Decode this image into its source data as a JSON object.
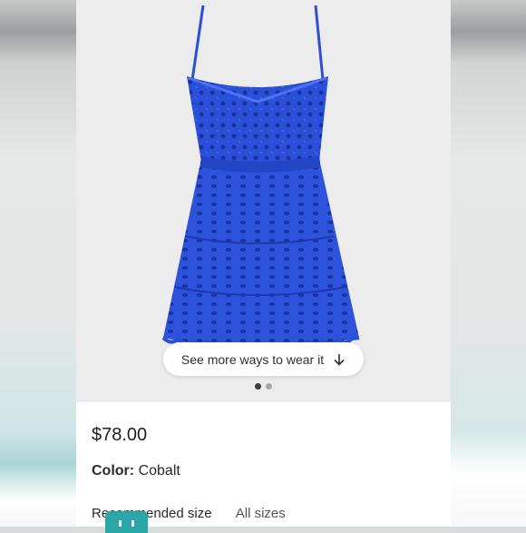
{
  "product": {
    "price": "$78.00",
    "color_label": "Color:",
    "color_value": "Cobalt",
    "dress_color": "#2a4fd8"
  },
  "gallery": {
    "wear_button_label": "See more ways to wear it",
    "wear_button_icon": "arrow-down-icon",
    "slide_count": 2,
    "active_slide": 1
  },
  "sizes": {
    "recommended_label": "Recommended size",
    "all_sizes_label": "All sizes"
  },
  "overlay": {
    "badge_icon": "chat-bot-icon",
    "badge_color": "#2aa6a6"
  }
}
